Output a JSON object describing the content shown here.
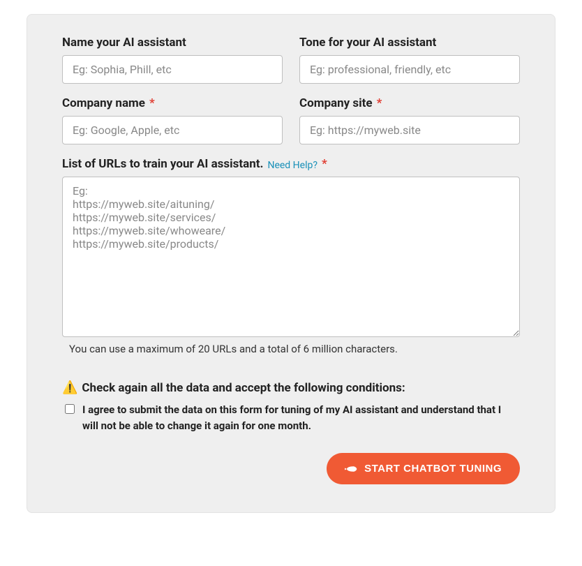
{
  "fields": {
    "name": {
      "label": "Name your AI assistant",
      "placeholder": "Eg: Sophia, Phill, etc",
      "value": ""
    },
    "tone": {
      "label": "Tone for your AI assistant",
      "placeholder": "Eg: professional, friendly, etc",
      "value": ""
    },
    "company_name": {
      "label": "Company name",
      "placeholder": "Eg: Google, Apple, etc",
      "value": ""
    },
    "company_site": {
      "label": "Company site",
      "placeholder": "Eg: https://myweb.site",
      "value": ""
    },
    "urls": {
      "label": "List of URLs to train your AI assistant.",
      "help_label": "Need Help?",
      "placeholder": "Eg:\nhttps://myweb.site/aituning/\nhttps://myweb.site/services/\nhttps://myweb.site/whoweare/\nhttps://myweb.site/products/",
      "value": "",
      "hint": "You can use a maximum of 20 URLs and a total of 6 million characters."
    }
  },
  "required_mark": "*",
  "conditions": {
    "icon": "⚠️",
    "title": "Check again all the data and accept the following conditions:",
    "consent": "I agree to submit the data on this form for tuning of my AI assistant and understand that I will not be able to change it again for one month."
  },
  "submit_label": "START CHATBOT TUNING"
}
